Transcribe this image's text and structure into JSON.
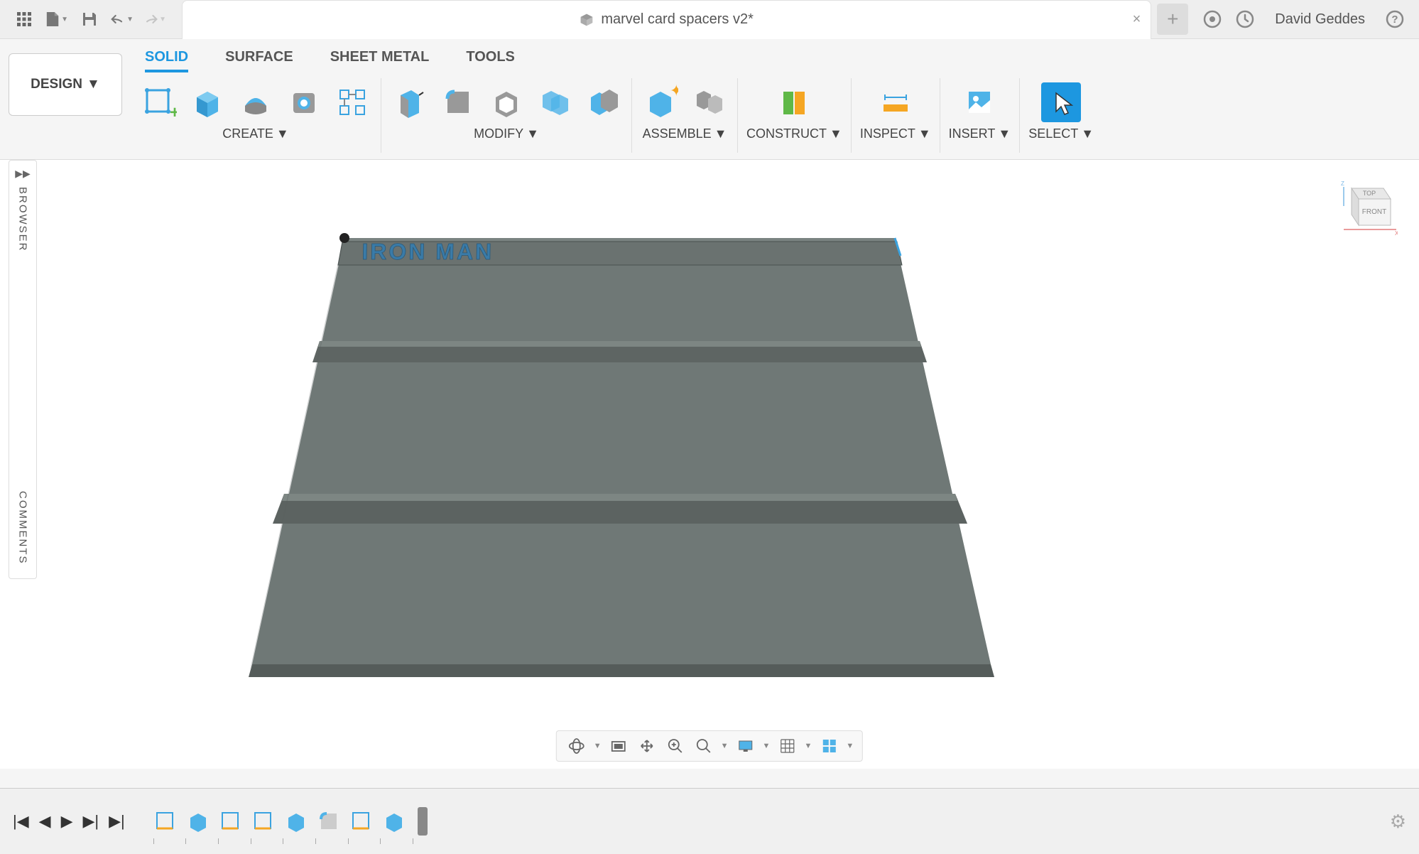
{
  "top": {
    "document_title": "marvel card spacers v2*",
    "user_name": "David Geddes"
  },
  "ribbon": {
    "design_label": "DESIGN",
    "tabs": [
      "SOLID",
      "SURFACE",
      "SHEET METAL",
      "TOOLS"
    ],
    "active_tab": 0,
    "groups": {
      "create": "CREATE",
      "modify": "MODIFY",
      "assemble": "ASSEMBLE",
      "construct": "CONSTRUCT",
      "inspect": "INSPECT",
      "insert": "INSERT",
      "select": "SELECT"
    }
  },
  "panels": {
    "browser": "BROWSER",
    "comments": "COMMENTS"
  },
  "viewcube": {
    "top": "TOP",
    "front": "FRONT"
  },
  "model": {
    "engraved_text": "IRON MAN"
  }
}
